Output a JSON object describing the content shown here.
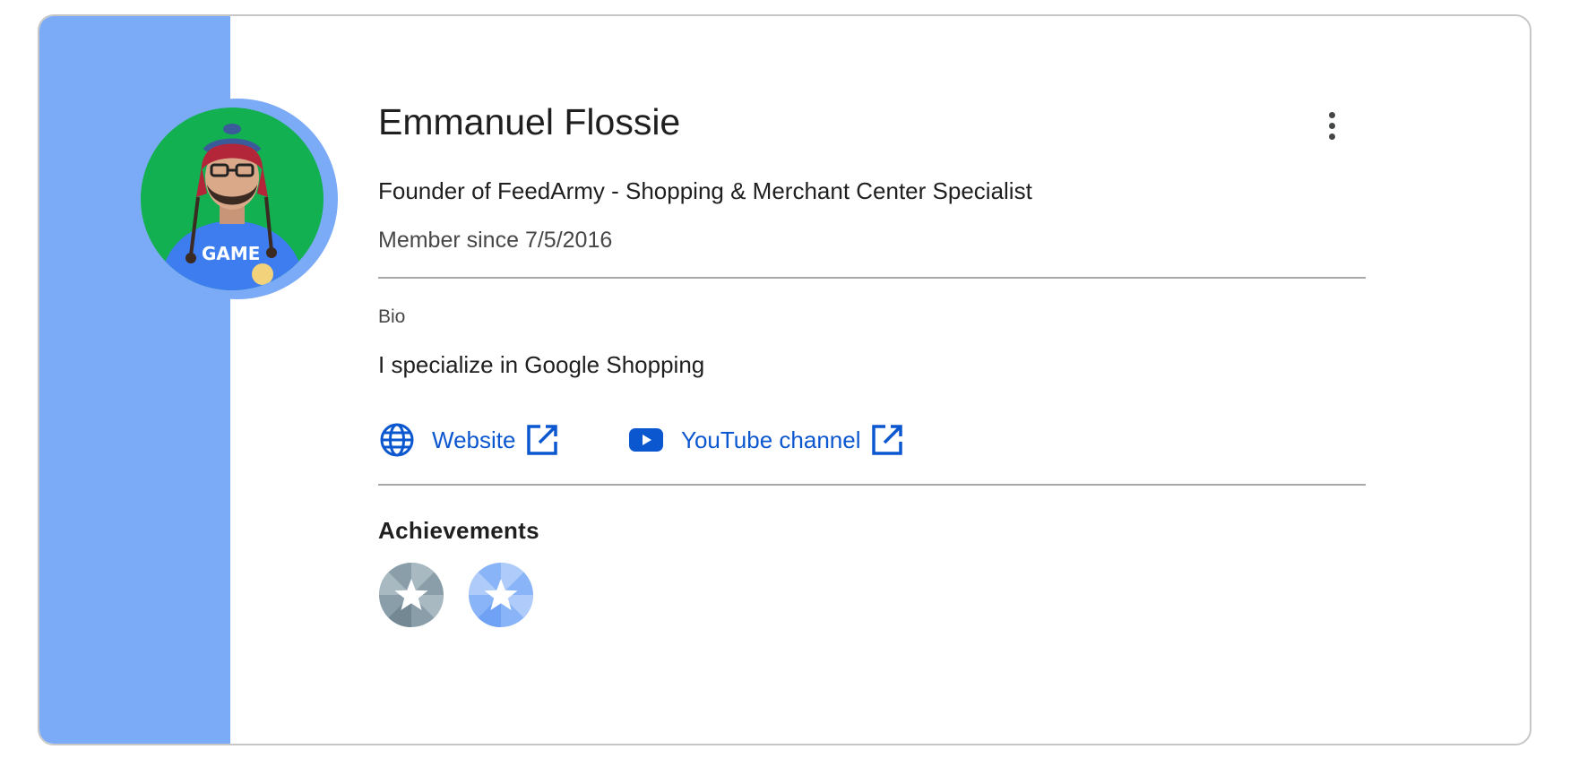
{
  "profile": {
    "name": "Emmanuel Flossie",
    "title": "Founder of FeedArmy - Shopping & Merchant Center Specialist",
    "member_since": "Member since 7/5/2016",
    "bio_label": "Bio",
    "bio_text": "I specialize in Google Shopping",
    "achievements_label": "Achievements"
  },
  "links": [
    {
      "label": "Website",
      "icon": "globe-icon",
      "ext_icon": "open-in-new-icon"
    },
    {
      "label": "YouTube channel",
      "icon": "youtube-icon",
      "ext_icon": "open-in-new-icon"
    }
  ],
  "achievements": [
    {
      "icon": "star-badge-icon",
      "color": "#78909c"
    },
    {
      "icon": "star-badge-icon",
      "color": "#8ab4f8"
    }
  ],
  "colors": {
    "accent_band": "#7baaf7",
    "link": "#0b57d0",
    "avatar_background": "#12b050"
  },
  "icons": {
    "more": "more-vert-icon"
  }
}
